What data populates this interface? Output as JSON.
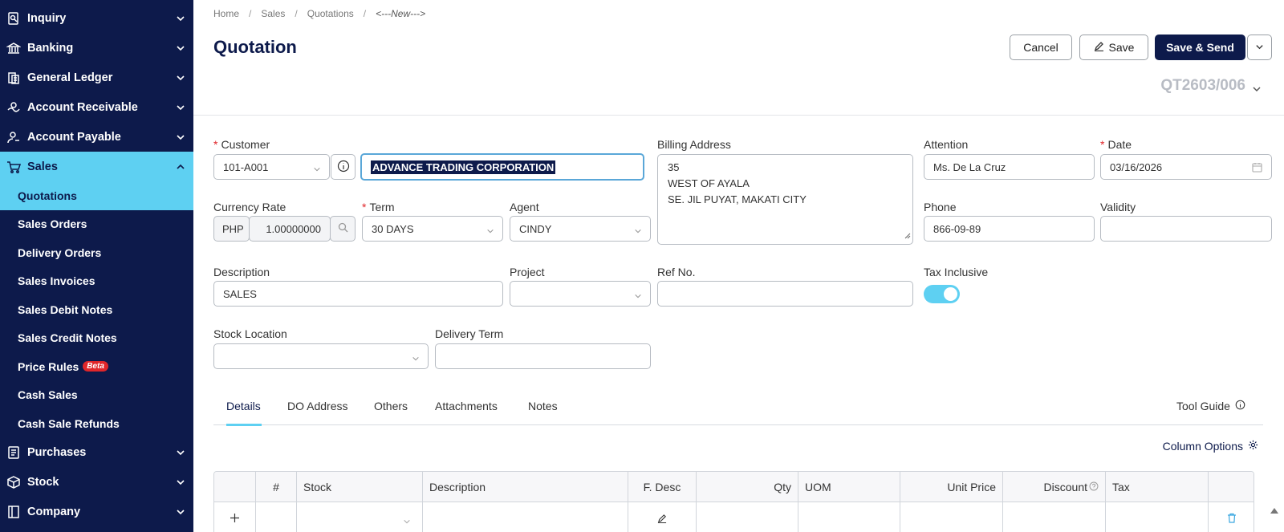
{
  "sidebar": {
    "groups": [
      {
        "label": "Inquiry",
        "icon": "inquiry-icon"
      },
      {
        "label": "Banking",
        "icon": "bank-icon"
      },
      {
        "label": "General Ledger",
        "icon": "ledger-icon"
      },
      {
        "label": "Account Receivable",
        "icon": "receivable-icon"
      },
      {
        "label": "Account Payable",
        "icon": "payable-icon"
      },
      {
        "label": "Sales",
        "icon": "cart-icon"
      },
      {
        "label": "Purchases",
        "icon": "purchases-icon"
      },
      {
        "label": "Stock",
        "icon": "box-icon"
      },
      {
        "label": "Company",
        "icon": "company-icon"
      }
    ],
    "sales_items": [
      "Quotations",
      "Sales Orders",
      "Delivery Orders",
      "Sales Invoices",
      "Sales Debit Notes",
      "Sales Credit Notes",
      "Price Rules",
      "Cash Sales",
      "Cash Sale Refunds"
    ],
    "beta_badge": "Beta"
  },
  "breadcrumb": {
    "home": "Home",
    "sales": "Sales",
    "quotations": "Quotations",
    "current": "<---New--->"
  },
  "page": {
    "title": "Quotation",
    "doc_no": "QT2603/006"
  },
  "toolbar": {
    "cancel": "Cancel",
    "save": "Save",
    "save_send": "Save & Send"
  },
  "form": {
    "customer_label": "Customer",
    "customer_code": "101-A001",
    "customer_name": "ADVANCE TRADING CORPORATION",
    "billing_label": "Billing Address",
    "billing_lines": [
      "35",
      "WEST OF AYALA",
      "SE. JIL PUYAT, MAKATI CITY"
    ],
    "attention_label": "Attention",
    "attention_value": "Ms. De La Cruz",
    "date_label": "Date",
    "date_value": "03/16/2026",
    "currency_label": "Currency Rate",
    "currency_code": "PHP",
    "currency_rate": "1.00000000",
    "term_label": "Term",
    "term_value": "30 DAYS",
    "agent_label": "Agent",
    "agent_value": "CINDY",
    "phone_label": "Phone",
    "phone_value": "866-09-89",
    "validity_label": "Validity",
    "validity_value": "",
    "description_label": "Description",
    "description_value": "SALES",
    "project_label": "Project",
    "project_value": "",
    "refno_label": "Ref No.",
    "refno_value": "",
    "tax_inclusive_label": "Tax Inclusive",
    "tax_inclusive": true,
    "stock_location_label": "Stock Location",
    "stock_location_value": "",
    "delivery_term_label": "Delivery Term",
    "delivery_term_value": ""
  },
  "tabs": [
    "Details",
    "DO Address",
    "Others",
    "Attachments",
    "Notes"
  ],
  "tool_guide": "Tool Guide",
  "column_options": "Column Options",
  "table": {
    "columns": [
      "#",
      "Stock",
      "Description",
      "F. Desc",
      "Qty",
      "UOM",
      "Unit Price",
      "Discount",
      "Tax"
    ]
  },
  "colors": {
    "sidebar_bg": "#0d1a4b",
    "accent": "#5ed0f2",
    "primary": "#0d1a4b",
    "required": "#e0262a"
  }
}
